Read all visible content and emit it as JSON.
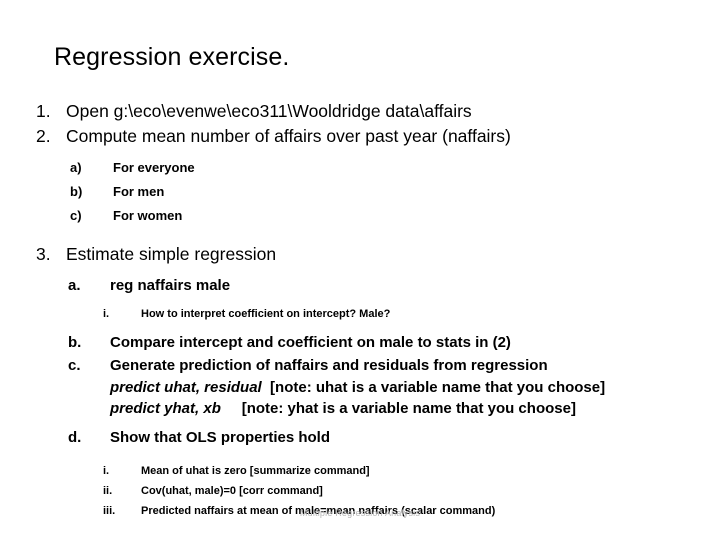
{
  "slide": {
    "title": "Regression exercise.",
    "footer": "Multiple Regression Analysis",
    "items": {
      "n1": {
        "marker": "1.",
        "text": "Open  g:\\eco\\evenwe\\eco311\\Wooldridge data\\affairs"
      },
      "n2": {
        "marker": "2.",
        "text": "Compute mean number of affairs over past year (naffairs)"
      },
      "n2a": {
        "marker": "a)",
        "text": "For everyone"
      },
      "n2b": {
        "marker": "b)",
        "text": "For men"
      },
      "n2c": {
        "marker": "c)",
        "text": "For women"
      },
      "n3": {
        "marker": "3.",
        "text": "Estimate simple regression"
      },
      "n3a": {
        "marker": "a.",
        "text": "reg naffairs male"
      },
      "n3a_i": {
        "marker": "i.",
        "text": "How to interpret coefficient on intercept?  Male?"
      },
      "n3b": {
        "marker": "b.",
        "text": "Compare intercept and coefficient on male to stats in (2)"
      },
      "n3c": {
        "marker": "c.",
        "text": "Generate prediction of naffairs and residuals from regression"
      },
      "n3c_line1": {
        "command": "predict uhat, residual",
        "note": "  [note: uhat is a variable name that you choose]"
      },
      "n3c_line2": {
        "command": "predict yhat, xb",
        "note": "     [note: yhat is a variable name that you choose]"
      },
      "n3d": {
        "marker": "d.",
        "text": "Show that OLS properties hold"
      },
      "n3d_i": {
        "marker": "i.",
        "text": "Mean of uhat is zero  [summarize command]"
      },
      "n3d_ii": {
        "marker": "ii.",
        "text": "Cov(uhat, male)=0   [corr command]"
      },
      "n3d_iii": {
        "marker": "iii.",
        "text": "Predicted naffairs at mean of male=mean naffairs  (scalar command)"
      }
    }
  }
}
